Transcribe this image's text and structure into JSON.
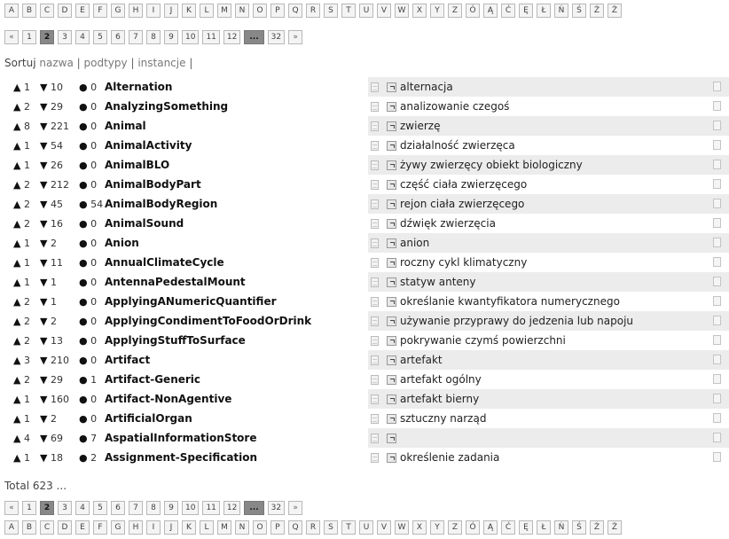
{
  "letters": [
    "A",
    "B",
    "C",
    "D",
    "E",
    "F",
    "G",
    "H",
    "I",
    "J",
    "K",
    "L",
    "M",
    "N",
    "O",
    "P",
    "Q",
    "R",
    "S",
    "T",
    "U",
    "V",
    "W",
    "X",
    "Y",
    "Z",
    "Ó",
    "Ą",
    "Ć",
    "Ę",
    "Ł",
    "Ń",
    "Ś",
    "Ź",
    "Ż"
  ],
  "pager": {
    "prev": "«",
    "pages": [
      "1",
      "2",
      "3",
      "4",
      "5",
      "6",
      "7",
      "8",
      "9",
      "10",
      "11",
      "12"
    ],
    "current": "2",
    "ellipsis": "...",
    "last": "32",
    "next": "»"
  },
  "sort": {
    "label": "Sortuj",
    "options": [
      "nazwa",
      "podtypy",
      "instancje"
    ],
    "sep": "|"
  },
  "rows": [
    {
      "up": "1",
      "down": "10",
      "dot": "0",
      "name": "Alternation",
      "translation": "alternacja"
    },
    {
      "up": "2",
      "down": "29",
      "dot": "0",
      "name": "AnalyzingSomething",
      "translation": "analizowanie czegoś"
    },
    {
      "up": "8",
      "down": "221",
      "dot": "0",
      "name": "Animal",
      "translation": "zwierzę"
    },
    {
      "up": "1",
      "down": "54",
      "dot": "0",
      "name": "AnimalActivity",
      "translation": "działalność zwierzęca"
    },
    {
      "up": "1",
      "down": "26",
      "dot": "0",
      "name": "AnimalBLO",
      "translation": "żywy zwierzęcy obiekt biologiczny"
    },
    {
      "up": "2",
      "down": "212",
      "dot": "0",
      "name": "AnimalBodyPart",
      "translation": "część ciała zwierzęcego"
    },
    {
      "up": "2",
      "down": "45",
      "dot": "54",
      "name": "AnimalBodyRegion",
      "translation": "rejon ciała zwierzęcego"
    },
    {
      "up": "2",
      "down": "16",
      "dot": "0",
      "name": "AnimalSound",
      "translation": "dźwięk zwierzęcia"
    },
    {
      "up": "1",
      "down": "2",
      "dot": "0",
      "name": "Anion",
      "translation": "anion"
    },
    {
      "up": "1",
      "down": "11",
      "dot": "0",
      "name": "AnnualClimateCycle",
      "translation": "roczny cykl klimatyczny"
    },
    {
      "up": "1",
      "down": "1",
      "dot": "0",
      "name": "AntennaPedestalMount",
      "translation": "statyw anteny"
    },
    {
      "up": "2",
      "down": "1",
      "dot": "0",
      "name": "ApplyingANumericQuantifier",
      "translation": "określanie kwantyfikatora numerycznego"
    },
    {
      "up": "2",
      "down": "2",
      "dot": "0",
      "name": "ApplyingCondimentToFoodOrDrink",
      "translation": "używanie przyprawy do jedzenia lub napoju"
    },
    {
      "up": "2",
      "down": "13",
      "dot": "0",
      "name": "ApplyingStuffToSurface",
      "translation": "pokrywanie czymś powierzchni"
    },
    {
      "up": "3",
      "down": "210",
      "dot": "0",
      "name": "Artifact",
      "translation": "artefakt"
    },
    {
      "up": "2",
      "down": "29",
      "dot": "1",
      "name": "Artifact-Generic",
      "translation": "artefakt ogólny"
    },
    {
      "up": "1",
      "down": "160",
      "dot": "0",
      "name": "Artifact-NonAgentive",
      "translation": "artefakt bierny"
    },
    {
      "up": "1",
      "down": "2",
      "dot": "0",
      "name": "ArtificialOrgan",
      "translation": "sztuczny narząd"
    },
    {
      "up": "4",
      "down": "69",
      "dot": "7",
      "name": "AspatialInformationStore",
      "translation": ""
    },
    {
      "up": "1",
      "down": "18",
      "dot": "2",
      "name": "Assignment-Specification",
      "translation": "określenie zadania"
    }
  ],
  "total_text": "Total 623 ..."
}
